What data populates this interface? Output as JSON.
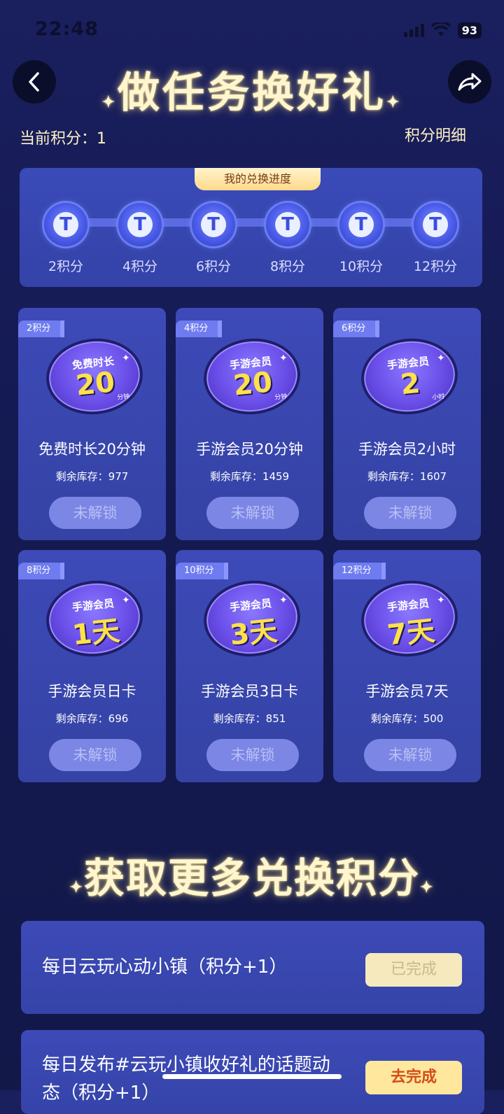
{
  "status": {
    "time": "22:48",
    "battery": "93"
  },
  "header": {
    "title": "做任务换好礼",
    "back_icon": "chevron-left-icon",
    "share_icon": "share-icon"
  },
  "points": {
    "current_label": "当前积分：1",
    "detail_link": "积分明细"
  },
  "progress": {
    "tab": "我的兑换进度",
    "nodes": [
      "2积分",
      "4积分",
      "6积分",
      "8积分",
      "10积分",
      "12积分"
    ],
    "node_glyph": "T"
  },
  "rewards": [
    {
      "badge": "2积分",
      "medal_top": "免费时长",
      "medal_big": "20",
      "medal_unit": "分钟",
      "title": "免费时长20分钟",
      "stock": "剩余库存：977",
      "button": "未解锁"
    },
    {
      "badge": "4积分",
      "medal_top": "手游会员",
      "medal_big": "20",
      "medal_unit": "分钟",
      "title": "手游会员20分钟",
      "stock": "剩余库存：1459",
      "button": "未解锁"
    },
    {
      "badge": "6积分",
      "medal_top": "手游会员",
      "medal_big": "2",
      "medal_unit": "小时",
      "title": "手游会员2小时",
      "stock": "剩余库存：1607",
      "button": "未解锁"
    },
    {
      "badge": "8积分",
      "medal_top": "手游会员",
      "medal_big": "1天",
      "medal_unit": "",
      "title": "手游会员日卡",
      "stock": "剩余库存：696",
      "button": "未解锁"
    },
    {
      "badge": "10积分",
      "medal_top": "手游会员",
      "medal_big": "3天",
      "medal_unit": "",
      "title": "手游会员3日卡",
      "stock": "剩余库存：851",
      "button": "未解锁"
    },
    {
      "badge": "12积分",
      "medal_top": "手游会员",
      "medal_big": "7天",
      "medal_unit": "",
      "title": "手游会员7天",
      "stock": "剩余库存：500",
      "button": "未解锁"
    }
  ],
  "section2": {
    "title": "获取更多兑换积分"
  },
  "tasks": [
    {
      "text": "每日云玩心动小镇（积分+1）",
      "button": "已完成"
    },
    {
      "text_line1": "每日发布#云玩小镇收好礼的话题动",
      "text_line2": "态（积分+1）",
      "button": "去完成"
    }
  ]
}
